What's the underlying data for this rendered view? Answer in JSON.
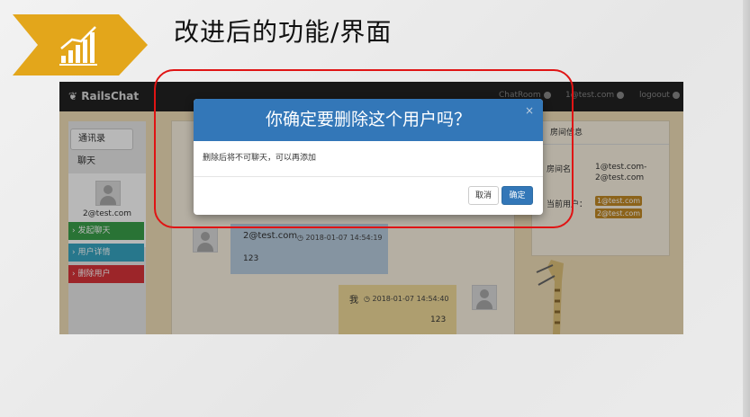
{
  "slide": {
    "title": "改进后的功能/界面",
    "banner_icon": "growth-chart-icon",
    "accent_color": "#e3a61b"
  },
  "app": {
    "brand": "RailsChat",
    "nav": {
      "chatroom": "ChatRoom",
      "user": "1@test.com",
      "logout": "logoout"
    }
  },
  "sidebar": {
    "tabs": [
      {
        "label": "通讯录"
      },
      {
        "label": "聊天"
      }
    ],
    "user": "2@test.com",
    "actions": [
      {
        "label": "› 发起聊天",
        "color": "#3aa04a"
      },
      {
        "label": "› 用户详情",
        "color": "#36a6c2"
      },
      {
        "label": "› 删除用户",
        "color": "#d9343a"
      }
    ]
  },
  "messages": [
    {
      "sender": "2@test.com",
      "time": "2018-01-07 14:54:19",
      "body": "123"
    },
    {
      "sender": "我",
      "time": "2018-01-07 14:54:40",
      "body": "123"
    }
  ],
  "room": {
    "header": "房间信息",
    "name_label": "房间名：",
    "name_value": "1@test.com-2@test.com",
    "users_label": "当前用户：",
    "users": [
      "1@test.com",
      "2@test.com"
    ]
  },
  "modal": {
    "title": "你确定要删除这个用户吗？",
    "close": "×",
    "body": "删除后将不可聊天，可以再添加",
    "cancel": "取消",
    "confirm": "确定"
  }
}
